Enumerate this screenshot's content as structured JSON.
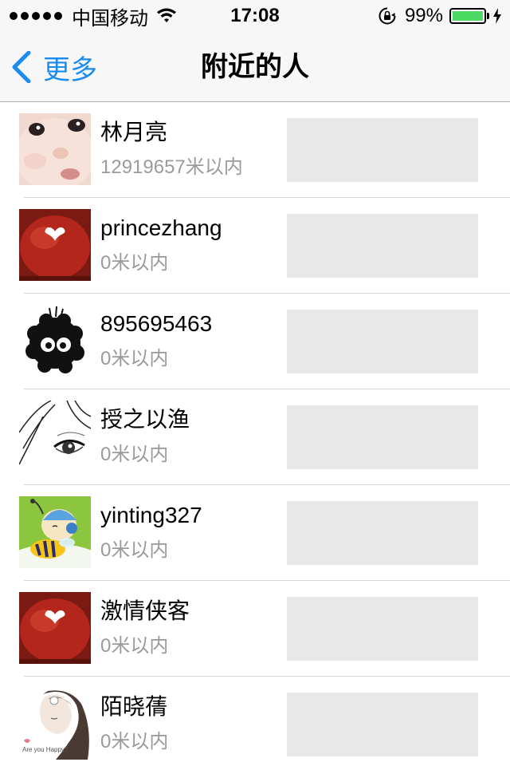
{
  "status_bar": {
    "carrier": "中国移动",
    "time": "17:08",
    "battery_percent": "99%",
    "battery_level": 0.99
  },
  "nav": {
    "back_label": "更多",
    "title": "附近的人"
  },
  "people": [
    {
      "name": "林月亮",
      "distance": "12919657米以内",
      "avatar": "baby-face-avatar"
    },
    {
      "name": "princezhang",
      "distance": "0米以内",
      "avatar": "red-apple-avatar"
    },
    {
      "name": "895695463",
      "distance": "0米以内",
      "avatar": "soot-sprite-avatar"
    },
    {
      "name": "授之以渔",
      "distance": "0米以内",
      "avatar": "sketch-eye-avatar"
    },
    {
      "name": "yinting327",
      "distance": "0米以内",
      "avatar": "cartoon-bee-avatar"
    },
    {
      "name": "激情侠客",
      "distance": "0米以内",
      "avatar": "red-apple-avatar"
    },
    {
      "name": "陌晓蒨",
      "distance": "0米以内",
      "avatar": "girl-drawing-avatar"
    }
  ],
  "avatar_texts": {
    "girl_caption": "Are you Happy?"
  },
  "colors": {
    "accent": "#1a8cf0",
    "battery": "#4cd964",
    "secondary_text": "#9b9b9b"
  }
}
